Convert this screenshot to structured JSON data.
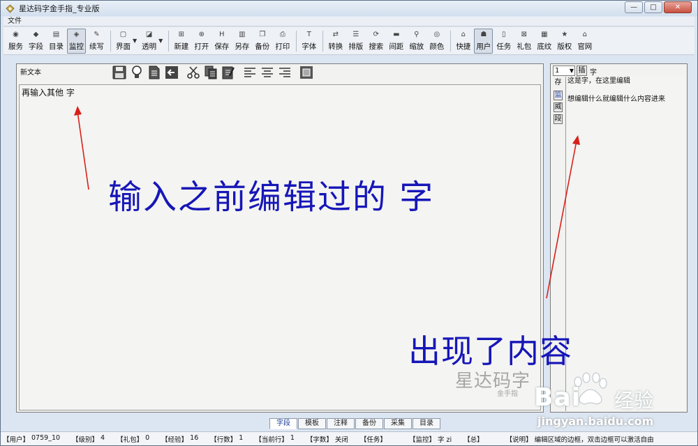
{
  "window": {
    "title": "星达码字金手指_专业版",
    "controls": {
      "minimize": "—",
      "maximize": "□",
      "close": "✕"
    }
  },
  "menubar": {
    "file": "文件"
  },
  "toolbar": [
    {
      "label": "服务",
      "icon": "rss-icon",
      "glyph": "◉",
      "active": false
    },
    {
      "label": "字段",
      "icon": "diamond-move-icon",
      "glyph": "◆",
      "active": false
    },
    {
      "label": "目录",
      "icon": "list-icon",
      "glyph": "▤",
      "active": false
    },
    {
      "label": "监控",
      "icon": "shield-icon",
      "glyph": "◈",
      "active": true
    },
    {
      "label": "续写",
      "icon": "pen-icon",
      "glyph": "✎",
      "active": false
    },
    {
      "label": "界面",
      "icon": "window-icon",
      "glyph": "▢",
      "active": false,
      "dropdown": true
    },
    {
      "label": "透明",
      "icon": "opacity-icon",
      "glyph": "◪",
      "active": false,
      "dropdown": true
    },
    {
      "label": "新建",
      "icon": "new-file-icon",
      "glyph": "⊞",
      "active": false
    },
    {
      "label": "打开",
      "icon": "open-icon",
      "glyph": "⊕",
      "active": false
    },
    {
      "label": "保存",
      "icon": "save-icon",
      "glyph": "H",
      "active": false
    },
    {
      "label": "另存",
      "icon": "save-as-icon",
      "glyph": "▥",
      "active": false
    },
    {
      "label": "备份",
      "icon": "backup-icon",
      "glyph": "❐",
      "active": false
    },
    {
      "label": "打印",
      "icon": "print-icon",
      "glyph": "⎙",
      "active": false
    },
    {
      "label": "字体",
      "icon": "font-icon",
      "glyph": "T",
      "active": false
    },
    {
      "label": "转换",
      "icon": "convert-icon",
      "glyph": "⇄",
      "active": false
    },
    {
      "label": "排版",
      "icon": "layout-icon",
      "glyph": "☰",
      "active": false
    },
    {
      "label": "搜索",
      "icon": "refresh-search-icon",
      "glyph": "⟳",
      "active": false
    },
    {
      "label": "间距",
      "icon": "spacing-icon",
      "glyph": "▬",
      "active": false
    },
    {
      "label": "缩放",
      "icon": "zoom-icon",
      "glyph": "⚲",
      "active": false
    },
    {
      "label": "颜色",
      "icon": "color-icon",
      "glyph": "◎",
      "active": false
    },
    {
      "label": "快捷",
      "icon": "shortcut-icon",
      "glyph": "⌂",
      "active": false
    },
    {
      "label": "用户",
      "icon": "user-icon",
      "glyph": "☗",
      "active": true
    },
    {
      "label": "任务",
      "icon": "task-icon",
      "glyph": "▯",
      "active": false
    },
    {
      "label": "礼包",
      "icon": "gift-icon",
      "glyph": "⊠",
      "active": false
    },
    {
      "label": "底纹",
      "icon": "texture-icon",
      "glyph": "▦",
      "active": false
    },
    {
      "label": "版权",
      "icon": "star-icon",
      "glyph": "★",
      "active": false
    },
    {
      "label": "官网",
      "icon": "home-icon",
      "glyph": "⌂",
      "active": false
    }
  ],
  "editor": {
    "panel_title": "新文本",
    "content": "再输入其他 字",
    "tools": [
      "save-icon",
      "bulb-icon",
      "document-icon",
      "back-arrow-icon",
      "scissors-icon",
      "copy-icon",
      "paste-icon",
      "align-left-icon",
      "align-center-icon",
      "align-right-icon",
      "fullscreen-icon"
    ]
  },
  "right_panel": {
    "select_value": "1",
    "insert_label": "插",
    "field_text": "字",
    "side_buttons": [
      "存",
      "监",
      "威",
      "段"
    ],
    "lines": [
      "这是字，在这里编辑",
      "",
      "想编辑什么就编辑什么内容进来"
    ]
  },
  "bottom_tabs": [
    "字段",
    "模板",
    "注释",
    "备份",
    "采集",
    "目录"
  ],
  "statusbar": [
    {
      "key": "【用户】",
      "value": "0759_10"
    },
    {
      "key": "【级别】",
      "value": "4"
    },
    {
      "key": "【礼包】",
      "value": "0"
    },
    {
      "key": "【经验】",
      "value": "16"
    },
    {
      "key": "【行数】",
      "value": "1"
    },
    {
      "key": "【当前行】",
      "value": "1"
    },
    {
      "key": "【字数】",
      "value": "关闭"
    },
    {
      "key": "【任务】",
      "value": ""
    },
    {
      "key": "【监控】",
      "value": "字 zi"
    },
    {
      "key": "【总】",
      "value": ""
    },
    {
      "key": "【说明】",
      "value": "编辑区域的边框，双击边框可以激活自由"
    }
  ],
  "annotations": {
    "left": "输入之前编辑过的    字",
    "right": "出现了内容",
    "arrow_color": "#d8201a"
  },
  "watermark": {
    "app_main": "星达码字",
    "app_sub": "金手指",
    "baidu": "Bai",
    "baidu_cn": "经验",
    "baidu_url": "jingyan.baidu.com"
  }
}
